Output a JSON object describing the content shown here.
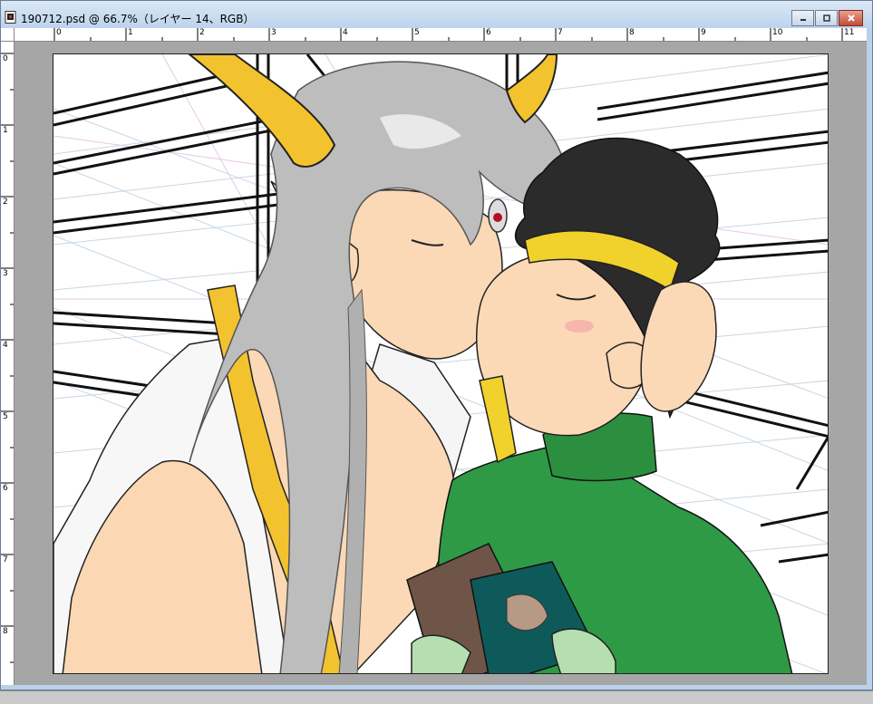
{
  "window": {
    "title": "190712.psd @ 66.7%（レイヤー 14、RGB）"
  },
  "rulers": {
    "top_labels": [
      "0",
      "1",
      "2",
      "3",
      "4",
      "5",
      "6",
      "7",
      "8",
      "9",
      "10",
      "11"
    ],
    "left_labels": [
      "0",
      "1",
      "2",
      "3",
      "4",
      "5",
      "6",
      "7",
      "8"
    ]
  },
  "icons": {
    "document": "document-icon",
    "minimize": "minimize-icon",
    "maximize": "maximize-icon",
    "close": "close-icon"
  },
  "colors": {
    "hair_silver": "#bdbdbd",
    "horns_gold": "#f2c32e",
    "skin": "#fcd9b6",
    "sweater_green": "#2f9a45",
    "book_brown": "#6f5548",
    "book_teal": "#0e5a5a",
    "headband_yellow": "#f1d22c",
    "gloves_green": "#b5dfb0"
  }
}
